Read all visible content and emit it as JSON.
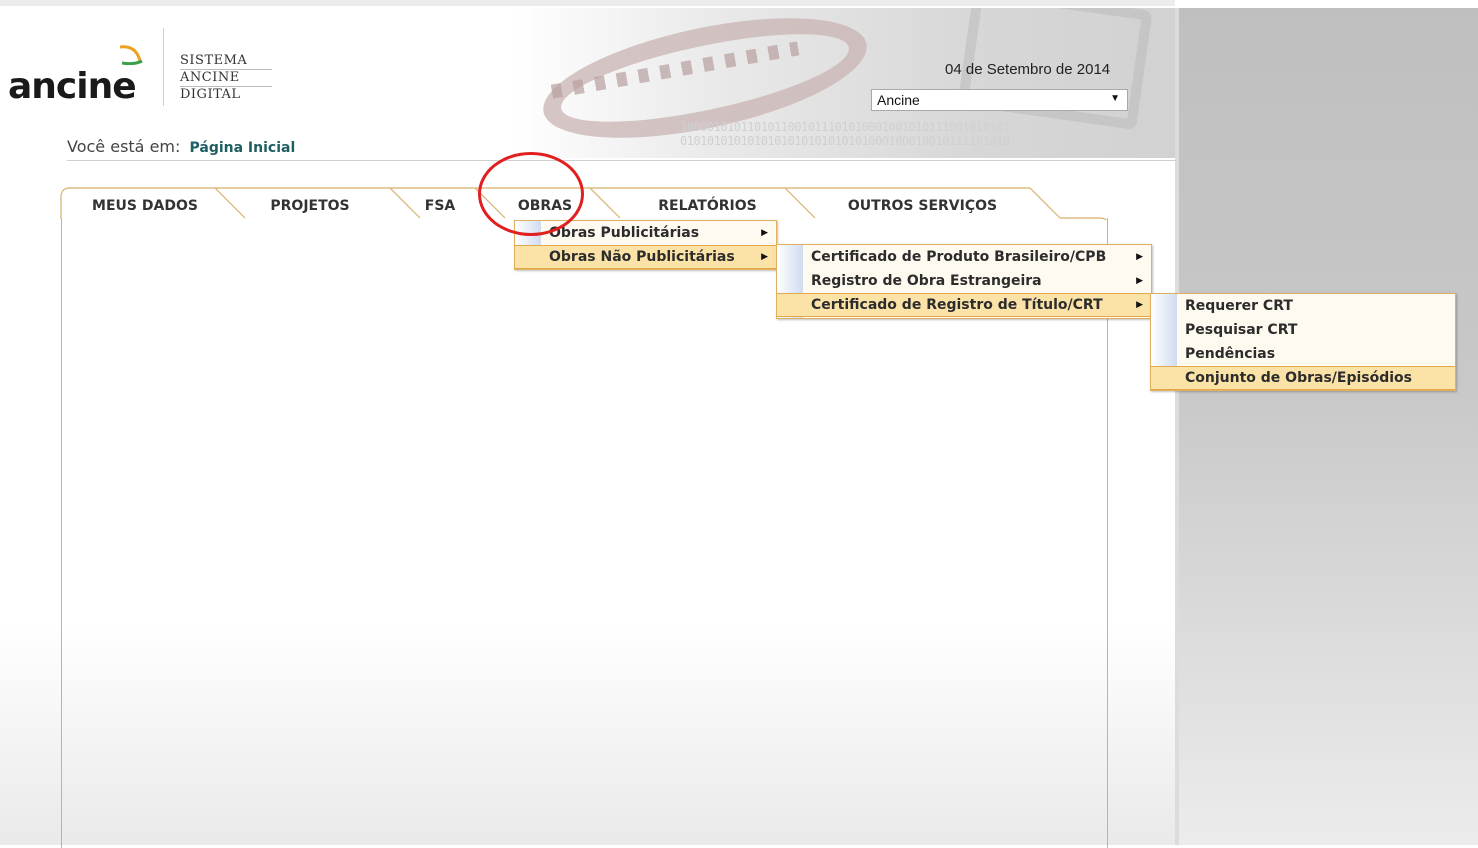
{
  "header": {
    "logo_text": "ancine",
    "logo_sub": [
      "SISTEMA",
      "ANCINE",
      "DIGITAL"
    ],
    "date": "04 de Setembro de 2014",
    "org_select": {
      "value": "Ancine"
    },
    "banner_binary": [
      "1000010101101011001011101010001001010111001010101",
      "0101010101010101010101010101000100010010111101010"
    ]
  },
  "breadcrumb": {
    "label": "Você está em:",
    "current": "Página Inicial"
  },
  "tabs": [
    {
      "label": "MEUS DADOS"
    },
    {
      "label": "PROJETOS"
    },
    {
      "label": "FSA"
    },
    {
      "label": "OBRAS"
    },
    {
      "label": "RELATÓRIOS"
    },
    {
      "label": "OUTROS SERVIÇOS"
    }
  ],
  "menu_obras": [
    {
      "label": "Obras Publicitárias",
      "has_submenu": true
    },
    {
      "label": "Obras Não Publicitárias",
      "has_submenu": true
    }
  ],
  "menu_nao_publicitarias": [
    {
      "label": "Certificado de Produto Brasileiro/CPB",
      "has_submenu": true
    },
    {
      "label": "Registro de Obra Estrangeira",
      "has_submenu": true
    },
    {
      "label": "Certificado de Registro de Título/CRT",
      "has_submenu": true
    }
  ],
  "menu_crt": [
    {
      "label": "Requerer CRT"
    },
    {
      "label": "Pesquisar CRT"
    },
    {
      "label": "Pendências"
    },
    {
      "label": "Conjunto de Obras/Episódios"
    }
  ],
  "colors": {
    "accent_border": "#d6b16a",
    "menu_highlight": "#fbe3a8",
    "annotation_circle": "#e02020",
    "breadcrumb_link": "#1f5e63"
  }
}
